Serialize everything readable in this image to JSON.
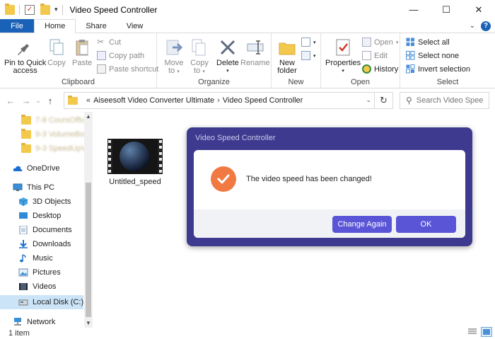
{
  "window": {
    "title": "Video Speed Controller",
    "minimize": "—",
    "maximize": "☐",
    "close": "✕"
  },
  "ribbon_tabs": [
    {
      "label": "File"
    },
    {
      "label": "Home"
    },
    {
      "label": "Share"
    },
    {
      "label": "View"
    }
  ],
  "ribbon": {
    "clipboard": {
      "label": "Clipboard",
      "pin_line1": "Pin to Quick",
      "pin_line2": "access",
      "copy": "Copy",
      "paste": "Paste",
      "cut": "Cut",
      "copy_path": "Copy path",
      "paste_shortcut": "Paste shortcut"
    },
    "organize": {
      "label": "Organize",
      "move_line1": "Move",
      "move_line2": "to",
      "copy_line1": "Copy",
      "copy_line2": "to",
      "delete": "Delete",
      "rename": "Rename"
    },
    "new": {
      "label": "New",
      "folder_line1": "New",
      "folder_line2": "folder"
    },
    "open": {
      "label": "Open",
      "properties": "Properties",
      "open": "Open",
      "edit": "Edit",
      "history": "History"
    },
    "select": {
      "label": "Select",
      "select_all": "Select all",
      "select_none": "Select none",
      "invert": "Invert selection"
    }
  },
  "address": {
    "prefix": "«",
    "crumb1": "Aiseesoft Video Converter Ultimate",
    "separator": "›",
    "crumb2": "Video Speed Controller",
    "search_placeholder": "Search Video Spee..."
  },
  "nav": {
    "blurred": [
      "7-8 CoursOffic",
      "9-3 VolumeBoo",
      "9-3 SpeedUpVi"
    ],
    "onedrive": "OneDrive",
    "thispc": "This PC",
    "objects3d": "3D Objects",
    "desktop": "Desktop",
    "documents": "Documents",
    "downloads": "Downloads",
    "music": "Music",
    "pictures": "Pictures",
    "videos": "Videos",
    "localdisk": "Local Disk (C:)",
    "network": "Network"
  },
  "files": [
    {
      "name": "Untitled_speed"
    }
  ],
  "dialog": {
    "title": "Video Speed Controller",
    "message": "The video speed has been changed!",
    "change_again": "Change Again",
    "ok": "OK"
  },
  "status": {
    "count": "1 item"
  },
  "colors": {
    "file_tab": "#1a62b8",
    "dialog_frame": "#3d3a8f",
    "dialog_button": "#5a55d6",
    "success_icon": "#f07a42",
    "selected_nav": "#cce4f7"
  }
}
